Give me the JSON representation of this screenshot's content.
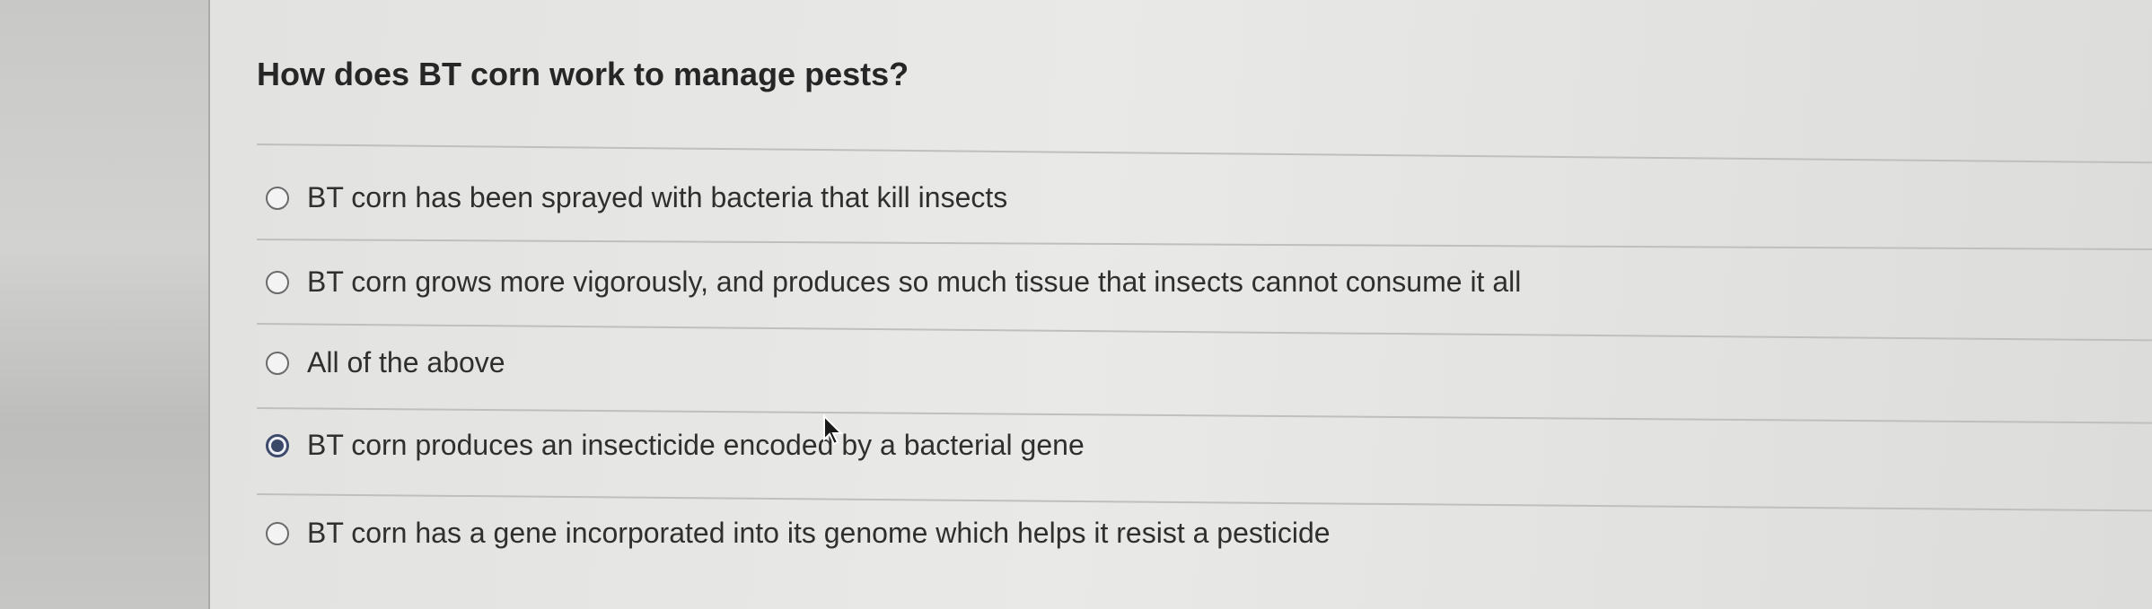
{
  "quiz": {
    "question": "How does BT corn work to manage pests?",
    "options": [
      {
        "label": "BT corn has been sprayed with bacteria that kill insects",
        "selected": false
      },
      {
        "label": "BT corn grows more vigorously, and produces so much tissue that insects cannot consume it all",
        "selected": false
      },
      {
        "label": "All of the above",
        "selected": false
      },
      {
        "label": "BT corn produces an insecticide encoded by a bacterial gene",
        "selected": true
      },
      {
        "label": "BT corn has a gene incorporated into its genome which helps it resist a pesticide",
        "selected": false
      }
    ]
  }
}
